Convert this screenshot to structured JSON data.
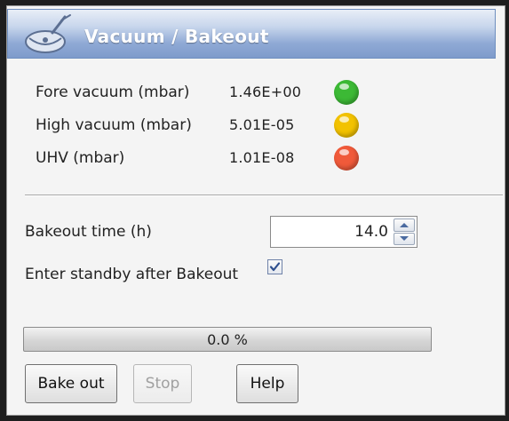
{
  "panel": {
    "title": "Vacuum / Bakeout",
    "icon": "vacuum-gauge-icon"
  },
  "readings": [
    {
      "label": "Fore vacuum (mbar)",
      "value": "1.46E+00",
      "status_color": "#3cb935"
    },
    {
      "label": "High vacuum (mbar)",
      "value": "5.01E-05",
      "status_color": "#f2c200"
    },
    {
      "label": "UHV (mbar)",
      "value": "1.01E-08",
      "status_color": "#f05a3a"
    }
  ],
  "bakeout": {
    "time_label": "Bakeout time (h)",
    "time_value": "14.0",
    "standby_label": "Enter standby after Bakeout",
    "standby_checked": true
  },
  "progress": {
    "value": 0.0,
    "text": "0.0 %"
  },
  "buttons": {
    "bake_out": "Bake out",
    "stop": "Stop",
    "help": "Help"
  }
}
